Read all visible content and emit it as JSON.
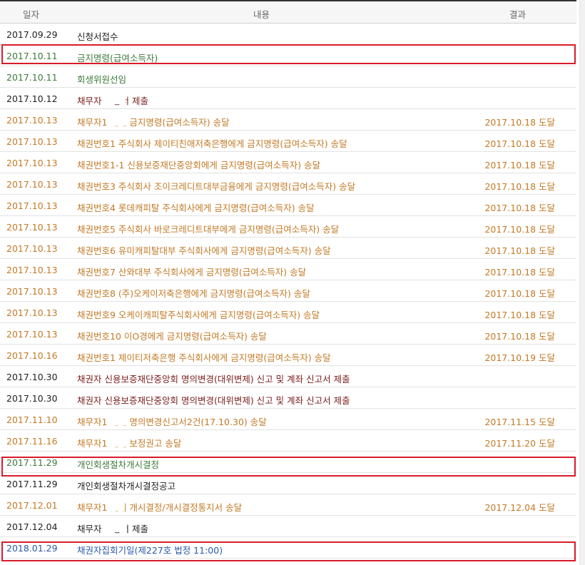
{
  "header": {
    "date": "일자",
    "content": "내용",
    "result": "결과"
  },
  "rows": [
    {
      "date": "2017.09.29",
      "content": "신청서접수",
      "result": "",
      "color": "black"
    },
    {
      "date": "2017.10.11",
      "content": "금지명령(급여소득자)",
      "result": "",
      "color": "green"
    },
    {
      "date": "2017.10.11",
      "content": "회생위원선임",
      "result": "",
      "color": "green"
    },
    {
      "date": "2017.10.12",
      "content": "채무자      보정서 제출",
      "result": "",
      "color": "maroon"
    },
    {
      "date": "2017.10.13",
      "content": "채무자1             에게 금지명령(급여소득자) 송달",
      "result": "2017.10.18 도달",
      "color": "orange"
    },
    {
      "date": "2017.10.13",
      "content": "채권번호1 주식회사 제이티친애저축은행에게 금지명령(급여소득자) 송달",
      "result": "2017.10.18 도달",
      "color": "orange"
    },
    {
      "date": "2017.10.13",
      "content": "채권번호1-1 신용보증재단중앙회에게 금지명령(급여소득자) 송달",
      "result": "2017.10.18 도달",
      "color": "orange"
    },
    {
      "date": "2017.10.13",
      "content": "채권번호3 주식회사 조이크레디트대부금융에게 금지명령(급여소득자) 송달",
      "result": "2017.10.18 도달",
      "color": "orange"
    },
    {
      "date": "2017.10.13",
      "content": "채권번호4 롯데캐피탈 주식회사에게 금지명령(급여소득자) 송달",
      "result": "2017.10.18 도달",
      "color": "orange"
    },
    {
      "date": "2017.10.13",
      "content": "채권번호5 주식회사 바로크레디트대부에게 금지명령(급여소득자) 송달",
      "result": "2017.10.18 도달",
      "color": "orange"
    },
    {
      "date": "2017.10.13",
      "content": "채권번호6 유미캐피탈대부 주식회사에게 금지명령(급여소득자) 송달",
      "result": "2017.10.18 도달",
      "color": "orange"
    },
    {
      "date": "2017.10.13",
      "content": "채권번호7 산와대부 주식회사에게 금지명령(급여소득자) 송달",
      "result": "2017.10.18 도달",
      "color": "orange"
    },
    {
      "date": "2017.10.13",
      "content": "채권번호8 (주)오케이저축은행에게 금지명령(급여소득자) 송달",
      "result": "2017.10.18 도달",
      "color": "orange"
    },
    {
      "date": "2017.10.13",
      "content": "채권번호9 오케이캐피탈주식회사에게 금지명령(급여소득자) 송달",
      "result": "2017.10.18 도달",
      "color": "orange"
    },
    {
      "date": "2017.10.13",
      "content": "채권번호10 이O경에게 금지명령(급여소득자) 송달",
      "result": "2017.10.18 도달",
      "color": "orange"
    },
    {
      "date": "2017.10.16",
      "content": "채권번호1 제이티저축은행 주식회사에게 금지명령(급여소득자) 송달",
      "result": "2017.10.19 도달",
      "color": "orange"
    },
    {
      "date": "2017.10.30",
      "content": "채권자 신용보증재단중앙회 명의변경(대위변제) 신고 및 계좌 신고서 제출",
      "result": "",
      "color": "maroon"
    },
    {
      "date": "2017.10.30",
      "content": "채권자 신용보증재단중앙회 명의변경(대위변제) 신고 및 계좌 신고서 제출",
      "result": "",
      "color": "maroon"
    },
    {
      "date": "2017.11.10",
      "content": "채무자1             에게 명의변경신고서2건(17.10.30) 송달",
      "result": "2017.11.15 도달",
      "color": "orange"
    },
    {
      "date": "2017.11.16",
      "content": "채무자1             에게 보정권고 송달",
      "result": "2017.11.20 도달",
      "color": "orange"
    },
    {
      "date": "2017.11.29",
      "content": "개인회생절차개시결정",
      "result": "",
      "color": "green"
    },
    {
      "date": "2017.11.29",
      "content": "개인회생절차개시결정공고",
      "result": "",
      "color": "black"
    },
    {
      "date": "2017.12.01",
      "content": "채무자1           에게 개시결정/개시결정통지서 송달",
      "result": "2017.12.04 도달",
      "color": "orange"
    },
    {
      "date": "2017.12.04",
      "content": "채무자        보정서 제출",
      "result": "",
      "color": "black"
    },
    {
      "date": "2018.01.29",
      "content": "채권자집회기일(제227호 법정 11:00)",
      "result": "",
      "color": "blue"
    }
  ]
}
